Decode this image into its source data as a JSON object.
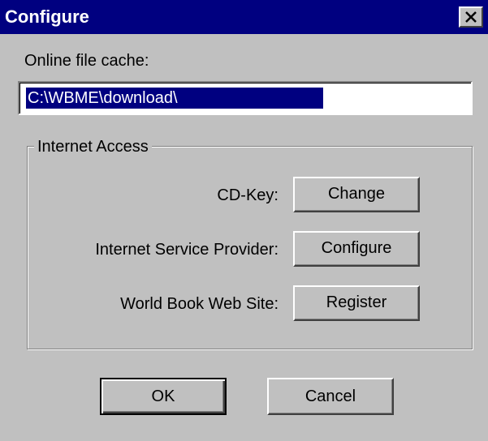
{
  "window": {
    "title": "Configure",
    "close_icon": "close-icon"
  },
  "cache": {
    "label": "Online file cache:",
    "value": "C:\\WBME\\download\\"
  },
  "internet_access": {
    "group_label": "Internet Access",
    "rows": [
      {
        "label": "CD-Key:",
        "button": "Change"
      },
      {
        "label": "Internet Service Provider:",
        "button": "Configure"
      },
      {
        "label": "World Book Web Site:",
        "button": "Register"
      }
    ]
  },
  "footer": {
    "ok_label": "OK",
    "cancel_label": "Cancel"
  },
  "colors": {
    "titlebar": "#000080",
    "face": "#c0c0c0",
    "selection": "#000080"
  }
}
